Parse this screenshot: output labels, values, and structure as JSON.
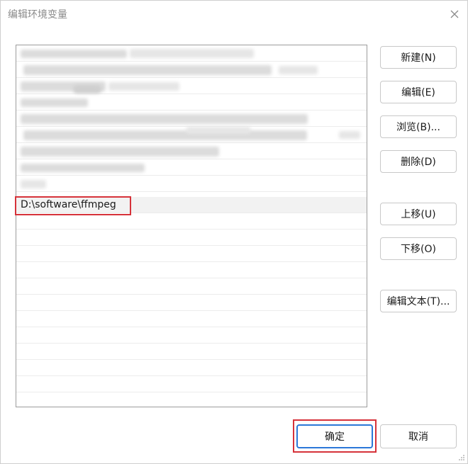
{
  "window": {
    "title": "编辑环境变量",
    "close_icon": "close-icon"
  },
  "list": {
    "visible_entry": "D:\\software\\ffmpeg"
  },
  "buttons": {
    "new": "新建(N)",
    "edit": "编辑(E)",
    "browse": "浏览(B)...",
    "delete": "删除(D)",
    "move_up": "上移(U)",
    "move_down": "下移(O)",
    "edit_text": "编辑文本(T)...",
    "ok": "确定",
    "cancel": "取消"
  },
  "colors": {
    "annotation_red": "#d6323a",
    "default_button_border": "#2b78d8"
  }
}
